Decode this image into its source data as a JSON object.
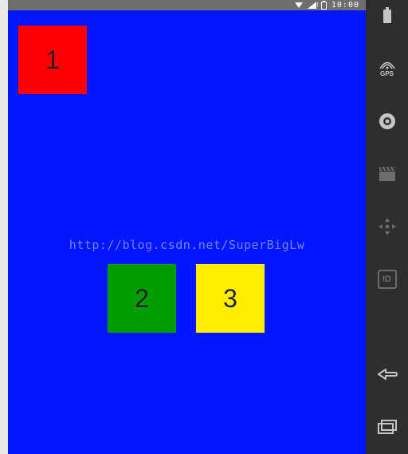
{
  "status_bar": {
    "time": "10:00"
  },
  "content": {
    "box1_label": "1",
    "box2_label": "2",
    "box3_label": "3",
    "watermark": "http://blog.csdn.net/SuperBigLw"
  },
  "sidebar": {
    "gps_label": "GPS",
    "id_label": "ID"
  }
}
